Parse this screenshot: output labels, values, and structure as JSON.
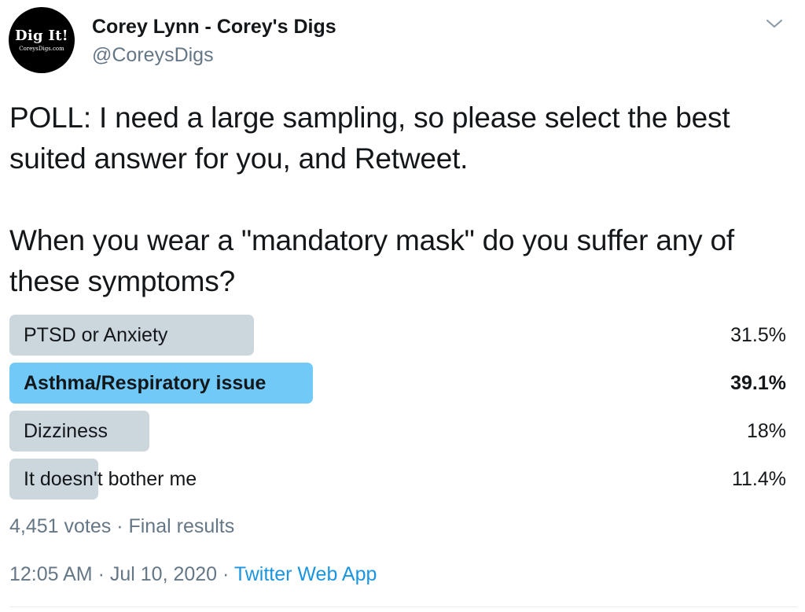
{
  "author": {
    "display_name": "Corey Lynn - Corey's Digs",
    "handle": "@CoreysDigs",
    "avatar": {
      "title": "Dig It!",
      "subtitle": "CoreysDigs.com"
    }
  },
  "tweet": {
    "text": "POLL: I need a large sampling, so please select the best suited answer for you, and Retweet.\n\nWhen you wear a \"mandatory mask\" do you suffer any of these symptoms?"
  },
  "poll": {
    "options": [
      {
        "label": "PTSD or Anxiety",
        "percent_text": "31.5%",
        "percent": 31.5,
        "winner": false
      },
      {
        "label": "Asthma/Respiratory issue",
        "percent_text": "39.1%",
        "percent": 39.1,
        "winner": true
      },
      {
        "label": "Dizziness",
        "percent_text": "18%",
        "percent": 18,
        "winner": false
      },
      {
        "label": "It doesn't bother me",
        "percent_text": "11.4%",
        "percent": 11.4,
        "winner": false
      }
    ],
    "votes": "4,451 votes",
    "separator": " · ",
    "status": "Final results"
  },
  "meta": {
    "time": "12:05 AM",
    "separator": " · ",
    "date": "Jul 10, 2020",
    "source": "Twitter Web App"
  },
  "colors": {
    "bar": "#ccd6dd",
    "bar_winner": "#71c9f8",
    "link": "#1b95e0",
    "secondary_text": "#657786"
  },
  "icons": {
    "more": "chevron-down-icon"
  }
}
